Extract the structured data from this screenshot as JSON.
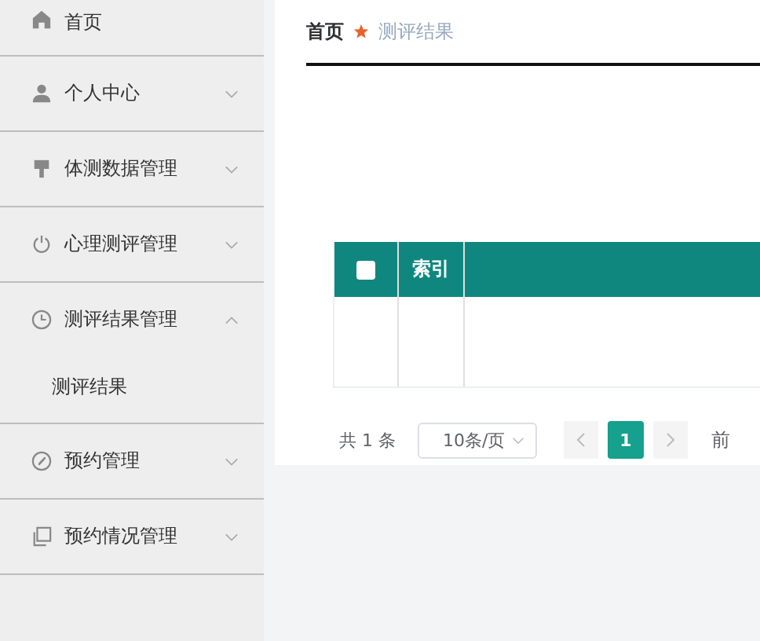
{
  "sidebar": {
    "items": [
      {
        "label": "首页",
        "expanded": false
      },
      {
        "label": "个人中心",
        "expanded": false
      },
      {
        "label": "体测数据管理",
        "expanded": false
      },
      {
        "label": "心理测评管理",
        "expanded": false
      },
      {
        "label": "测评结果管理",
        "expanded": true,
        "children": [
          {
            "label": "测评结果"
          }
        ]
      },
      {
        "label": "预约管理",
        "expanded": false
      },
      {
        "label": "预约情况管理",
        "expanded": false
      }
    ]
  },
  "breadcrumb": [
    {
      "label": "首页"
    },
    {
      "label": "测评结果"
    }
  ],
  "table": {
    "columns": [
      {
        "kind": "checkbox",
        "checked": false
      },
      {
        "kind": "text",
        "label": "索引"
      },
      {
        "kind": "blank"
      }
    ]
  },
  "pagination": {
    "total": "共 1 条",
    "page_size": "10条/页",
    "pages": [
      {
        "label": "1",
        "selected": true
      }
    ],
    "jump_label": "前"
  }
}
